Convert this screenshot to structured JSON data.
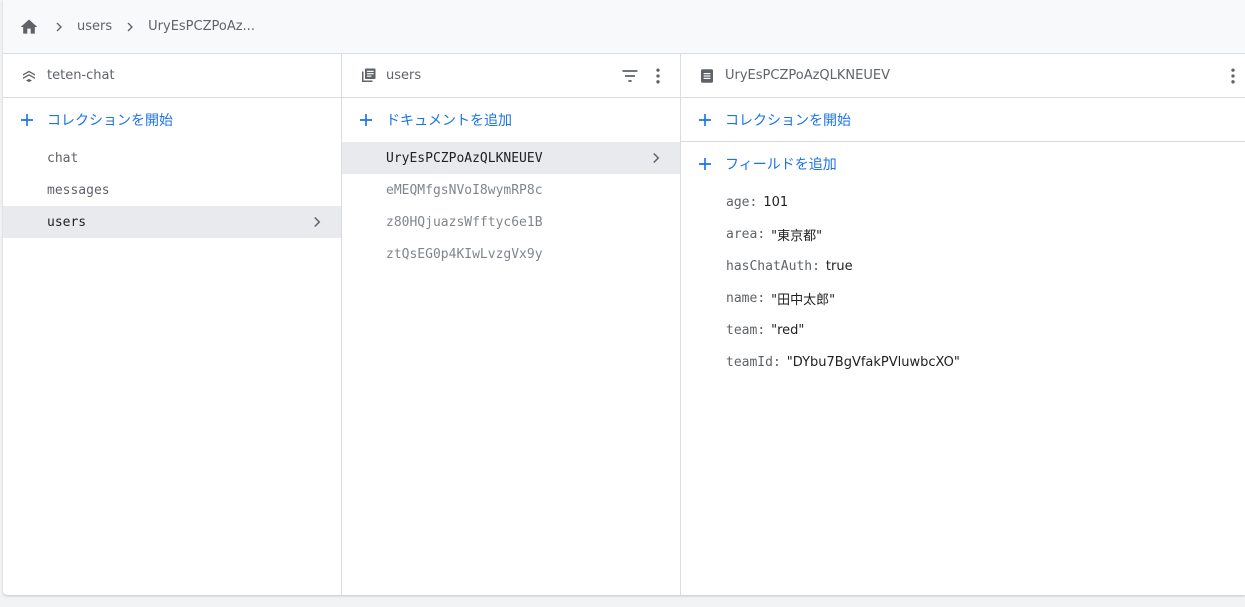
{
  "breadcrumb": {
    "home_icon": "home-icon",
    "items": [
      "users",
      "UryEsPCZPoAz..."
    ]
  },
  "columns": {
    "root": {
      "title": "teten-chat",
      "icon": "firestore-database-icon",
      "add_label": "コレクションを開始",
      "items": [
        "chat",
        "messages",
        "users"
      ],
      "selected": "users"
    },
    "collection": {
      "title": "users",
      "icon": "collection-icon",
      "add_label": "ドキュメントを追加",
      "items": [
        "UryEsPCZPoAzQLKNEUEV",
        "eMEQMfgsNVoI8wymRP8c",
        "z80HQjuazsWfftyc6e1B",
        "ztQsEG0p4KIwLvzgVx9y"
      ],
      "selected": "UryEsPCZPoAzQLKNEUEV"
    },
    "document": {
      "title": "UryEsPCZPoAzQLKNEUEV",
      "icon": "document-icon",
      "add_collection_label": "コレクションを開始",
      "add_field_label": "フィールドを追加",
      "fields": [
        {
          "key": "age",
          "value": "101"
        },
        {
          "key": "area",
          "value": "\"東京都\""
        },
        {
          "key": "hasChatAuth",
          "value": "true"
        },
        {
          "key": "name",
          "value": "\"田中太郎\""
        },
        {
          "key": "team",
          "value": "\"red\""
        },
        {
          "key": "teamId",
          "value": "\"DYbu7BgVfakPVluwbcXO\""
        }
      ]
    }
  },
  "colors": {
    "accent": "#1a73e8",
    "selected_bg": "#e8eaed",
    "border": "#dadce0"
  }
}
